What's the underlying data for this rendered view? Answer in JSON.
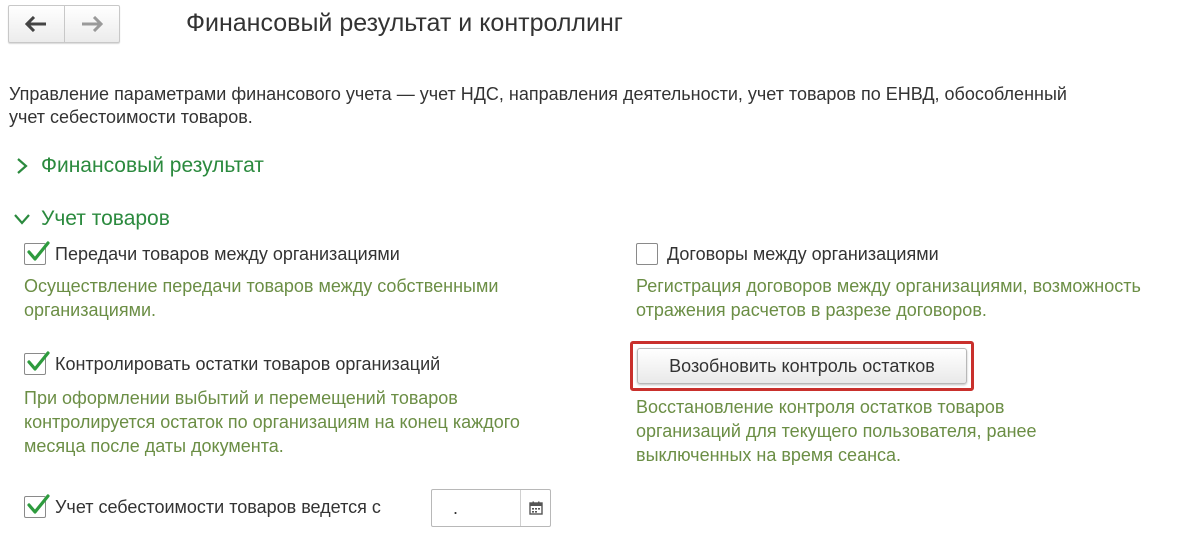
{
  "header": {
    "title": "Финансовый результат и контроллинг",
    "back_icon": "arrow-left-icon",
    "forward_icon": "arrow-right-icon"
  },
  "description": "Управление параметрами финансового учета — учет НДС, направления деятельности, учет товаров по ЕНВД, обособленный учет себестоимости товаров.",
  "sections": {
    "financial_result": {
      "label": "Финансовый результат",
      "expanded": false
    },
    "goods_accounting": {
      "label": "Учет товаров",
      "expanded": true
    }
  },
  "settings": {
    "transfers": {
      "label": "Передачи товаров между организациями",
      "checked": true,
      "hint": "Осуществление передачи товаров между собственными организациями."
    },
    "contracts": {
      "label": "Договоры между организациями",
      "checked": false,
      "hint": "Регистрация договоров между организациями, возможность отражения расчетов  в разрезе договоров."
    },
    "control_stock": {
      "label": "Контролировать остатки товаров организаций",
      "checked": true,
      "hint": "При оформлении выбытий и перемещений товаров контролируется остаток по организациям на конец каждого месяца после даты документа."
    },
    "resume_control": {
      "button_label": "Возобновить контроль остатков",
      "hint": "Восстановление контроля остатков товаров организаций для текущего пользователя, ранее выключенных на время сеанса."
    },
    "cost_accounting": {
      "label": "Учет себестоимости товаров ведется с",
      "checked": true,
      "date_value": " .",
      "calendar_icon": "calendar-icon"
    }
  },
  "colors": {
    "section_green": "#2b8a3e",
    "hint_green": "#6b8e45",
    "check_green": "#2e9b3e",
    "highlight_red": "#c9302c"
  }
}
